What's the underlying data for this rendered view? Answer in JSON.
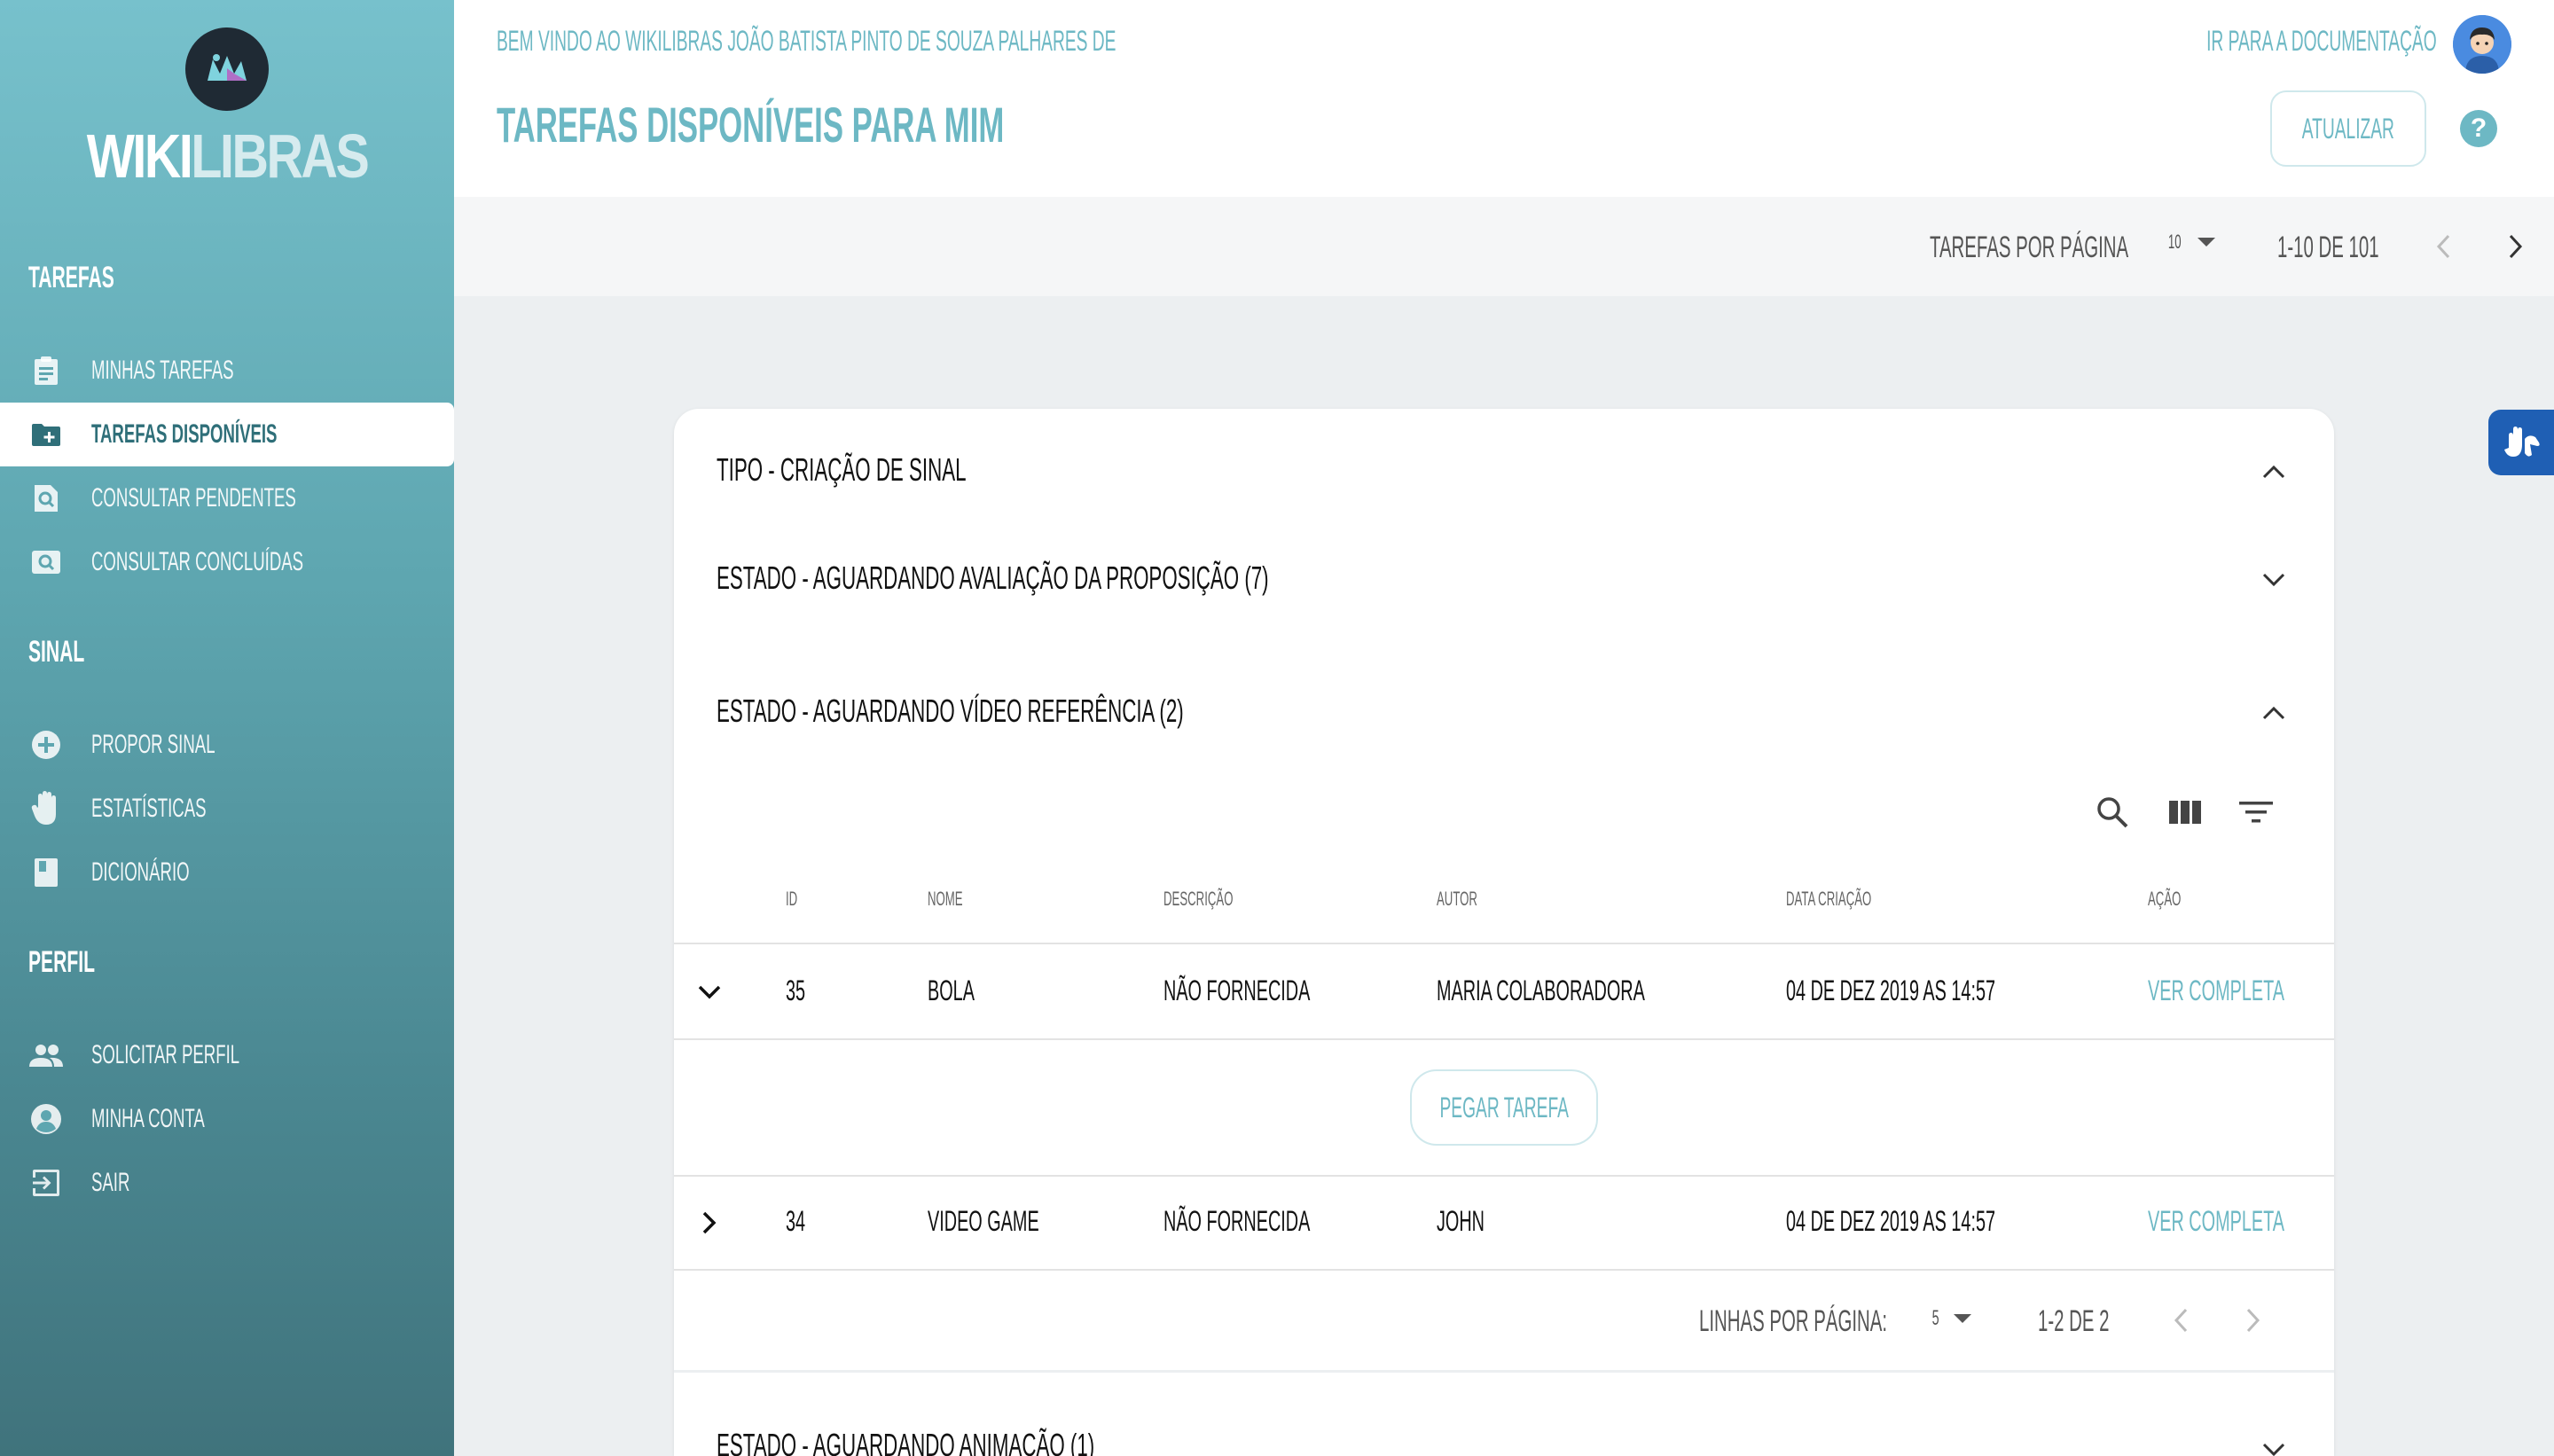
{
  "app": {
    "logo_part1": "WIKI",
    "logo_part2": "LIBRAS"
  },
  "sidebar": {
    "sections": [
      {
        "title": "TAREFAS",
        "items": [
          {
            "label": "MINHAS TAREFAS",
            "icon": "clipboard-icon"
          },
          {
            "label": "TAREFAS DISPONÍVEIS",
            "icon": "folder-add-icon",
            "active": true
          },
          {
            "label": "CONSULTAR PENDENTES",
            "icon": "search-document-icon"
          },
          {
            "label": "CONSULTAR CONCLUÍDAS",
            "icon": "search-image-icon"
          }
        ]
      },
      {
        "title": "SINAL",
        "items": [
          {
            "label": "PROPOR SINAL",
            "icon": "add-circle-icon"
          },
          {
            "label": "ESTATÍSTICAS",
            "icon": "hand-icon"
          },
          {
            "label": "DICIONÁRIO",
            "icon": "book-icon"
          }
        ]
      },
      {
        "title": "PERFIL",
        "items": [
          {
            "label": "SOLICITAR PERFIL",
            "icon": "people-icon"
          },
          {
            "label": "MINHA CONTA",
            "icon": "account-circle-icon"
          },
          {
            "label": "SAIR",
            "icon": "exit-icon"
          }
        ]
      }
    ]
  },
  "header": {
    "welcome": "BEM VINDO AO WIKILIBRAS JOÃO BATISTA PINTO DE SOUZA PALHARES DE",
    "title": "TAREFAS DISPONÍVEIS PARA MIM",
    "doc_link": "IR PARA A DOCUMENTAÇÃO",
    "refresh_label": "ATUALIZAR",
    "help": "?"
  },
  "pagination": {
    "label": "TAREFAS POR PÁGINA",
    "per_page": "10",
    "range": "1-10 DE 101"
  },
  "card": {
    "type_title": "TIPO - CRIAÇÃO DE SINAL",
    "panels": [
      {
        "title": "ESTADO - AGUARDANDO AVALIAÇÃO DA PROPOSIÇÃO (7)"
      },
      {
        "title": "ESTADO - AGUARDANDO VÍDEO REFERÊNCIA (2)"
      },
      {
        "title": "ESTADO - AGUARDANDO ANIMAÇÃO (1)"
      }
    ],
    "table": {
      "columns": [
        "ID",
        "NOME",
        "DESCRIÇÃO",
        "AUTOR",
        "DATA CRIAÇÃO",
        "AÇÃO"
      ],
      "rows": [
        {
          "id": "35",
          "nome": "BOLA",
          "descricao": "NÃO FORNECIDA",
          "autor": "MARIA COLABORADORA",
          "data": "04 DE DEZ 2019 AS 14:57",
          "acao": "VER COMPLETA"
        },
        {
          "id": "34",
          "nome": "VIDEO GAME",
          "descricao": "NÃO FORNECIDA",
          "autor": "JOHN",
          "data": "04 DE DEZ 2019 AS 14:57",
          "acao": "VER COMPLETA"
        }
      ],
      "take_task_label": "PEGAR TAREFA",
      "footer": {
        "label": "LINHAS POR PÁGINA:",
        "per_page": "5",
        "range": "1-2 DE 2"
      }
    }
  },
  "colors": {
    "accent": "#6db8c4",
    "sidebar_top": "#77c1cc",
    "sidebar_bottom": "#40737c",
    "a11y": "#1f5fb4"
  }
}
